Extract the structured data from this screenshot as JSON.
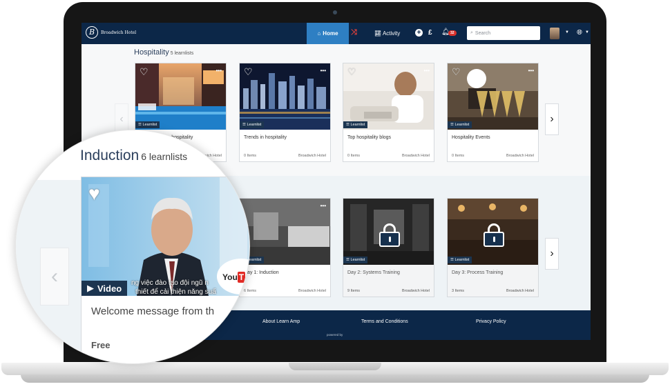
{
  "navbar": {
    "brand": "Broadwich Hotel",
    "brand_initial": "B",
    "home": "Home",
    "activity": "Activity",
    "notification_count": "32",
    "search_placeholder": "Search"
  },
  "sections": {
    "hospitality": {
      "title": "Hospitality",
      "count": "5 learnlists",
      "cards": [
        {
          "tag": "Learnlist",
          "title": "Introduction to hospitality",
          "items": "",
          "org": "Broadwich Hotel"
        },
        {
          "tag": "Learnlist",
          "title": "Trends in hospitality",
          "items": "0 Items",
          "org": "Broadwich Hotel"
        },
        {
          "tag": "Learnlist",
          "title": "Top hospitality blogs",
          "items": "0 Items",
          "org": "Broadwich Hotel"
        },
        {
          "tag": "Learnlist",
          "title": "Hospitality Events",
          "items": "0 Items",
          "org": "Broadwich Hotel"
        }
      ]
    },
    "induction": {
      "cards": [
        {
          "tag": "Learnlist",
          "title": "Day 1: Induction",
          "items": "6 Items",
          "org": "Broadwich Hotel"
        },
        {
          "tag": "Learnlist",
          "title": "Day 2: Systems Training",
          "items": "9 Items",
          "org": "Broadwich Hotel"
        },
        {
          "tag": "Learnlist",
          "title": "Day 3: Process Training",
          "items": "3 Items",
          "org": "Broadwich Hotel"
        }
      ]
    }
  },
  "footer": {
    "about": "About Learn Amp",
    "terms": "Terms and Conditions",
    "privacy": "Privacy Policy",
    "powered": "powered by"
  },
  "magnifier": {
    "title": "Induction",
    "count": "6 learnlists",
    "tag": "Video",
    "subtitle_line1": "ng việc đào tạo đội ngũ n",
    "subtitle_line2": "thiết để cải thiện năng suấ",
    "youtube": "You",
    "youtube_tube": "T",
    "card_title": "Welcome message from th",
    "price": "Free"
  }
}
